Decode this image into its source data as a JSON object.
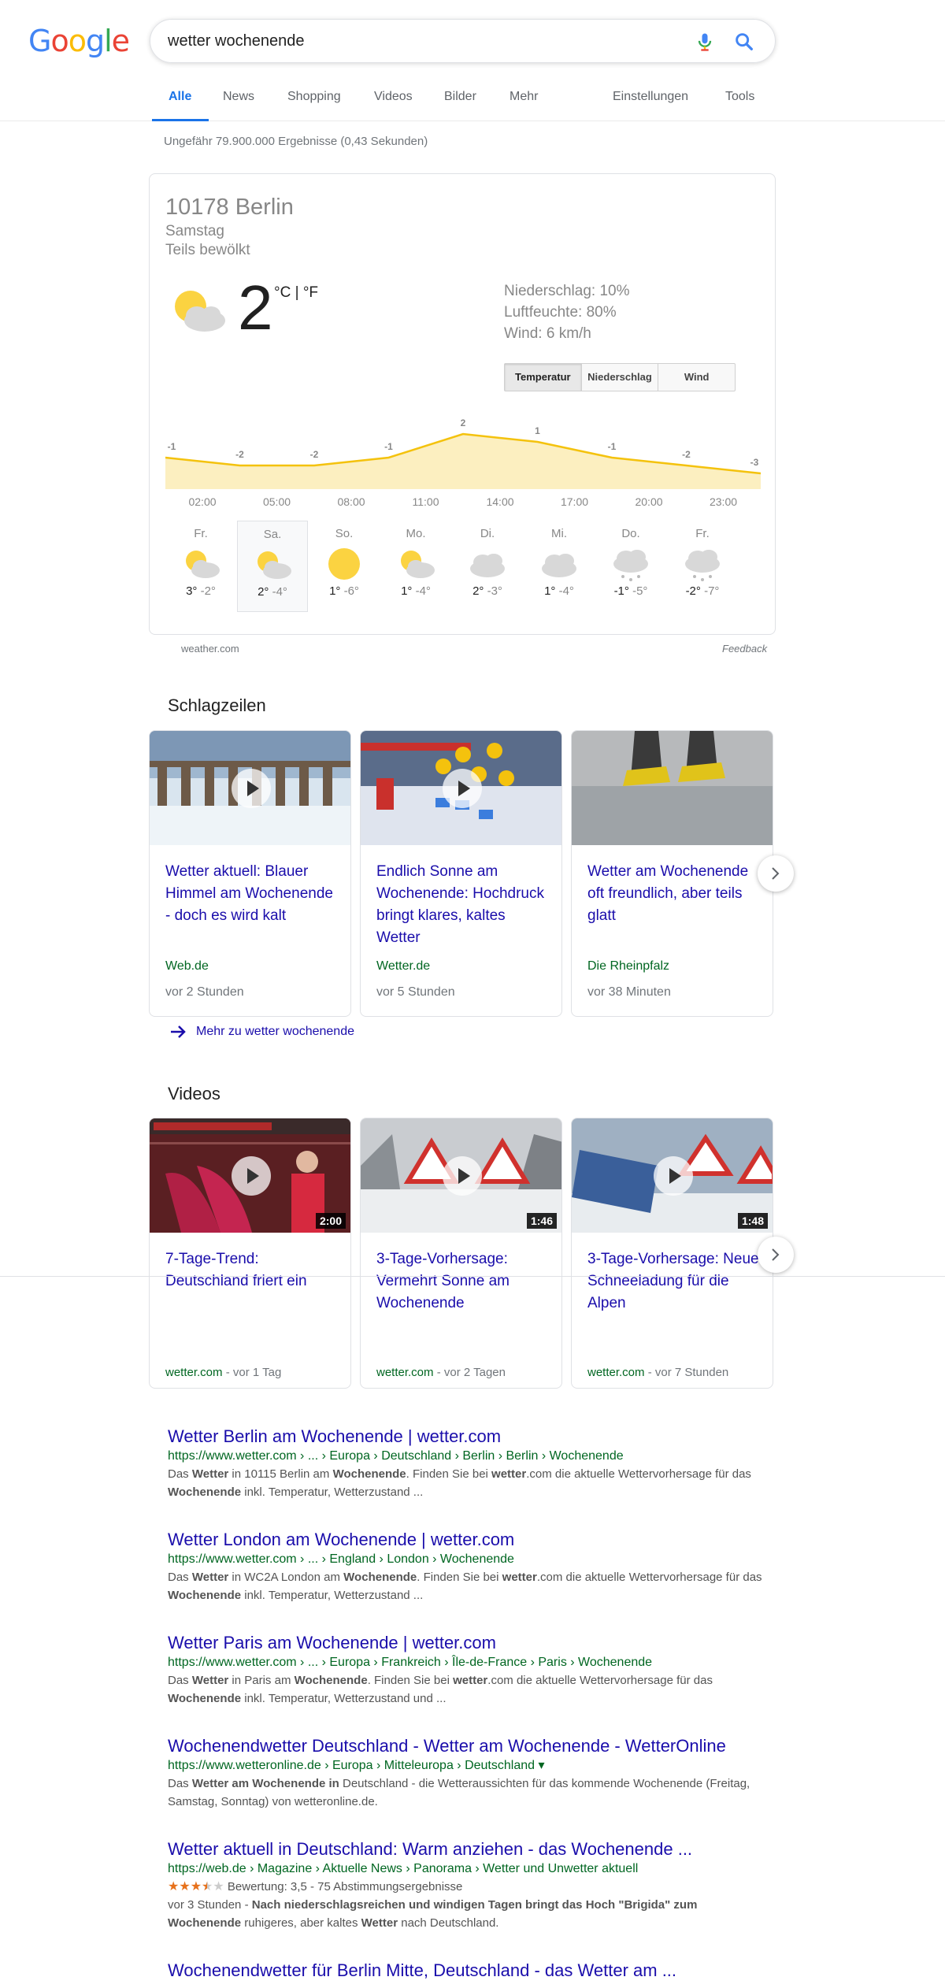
{
  "header": {
    "logo": [
      "G",
      "o",
      "o",
      "g",
      "l",
      "e"
    ],
    "logo_colors": [
      "#4285f4",
      "#ea4335",
      "#fbbc05",
      "#4285f4",
      "#34a853",
      "#ea4335"
    ],
    "query": "wetter wochenende"
  },
  "tabs": {
    "all": "Alle",
    "news": "News",
    "shopping": "Shopping",
    "videos": "Videos",
    "images": "Bilder",
    "more": "Mehr",
    "settings": "Einstellungen",
    "tools": "Tools"
  },
  "stats": "Ungefähr 79.900.000 Ergebnisse (0,43 Sekunden)",
  "weather": {
    "location": "10178 Berlin",
    "day": "Samstag",
    "condition": "Teils bewölkt",
    "temp": "2",
    "units": "°C | °F",
    "precipitation": "Niederschlag: 10%",
    "humidity": "Luftfeuchte: 80%",
    "wind": "Wind: 6 km/h",
    "buttons": [
      "Temperatur",
      "Niederschlag",
      "Wind"
    ],
    "chart_data": {
      "type": "area",
      "x": [
        "02:00",
        "05:00",
        "08:00",
        "11:00",
        "14:00",
        "17:00",
        "20:00",
        "23:00"
      ],
      "values": [
        -1,
        -2,
        -2,
        -1,
        2,
        1,
        -1,
        -2,
        -3
      ],
      "labels": [
        "-1",
        "-2",
        "-2",
        "-1",
        "2",
        "1",
        "-1",
        "-2",
        "-3"
      ],
      "color": "#f4c20d"
    },
    "forecast": [
      {
        "day": "Fr.",
        "hi": "3°",
        "lo": "-2°",
        "icon": "partly-cloudy-icon"
      },
      {
        "day": "Sa.",
        "hi": "2°",
        "lo": "-4°",
        "icon": "partly-cloudy-icon"
      },
      {
        "day": "So.",
        "hi": "1°",
        "lo": "-6°",
        "icon": "sunny-icon"
      },
      {
        "day": "Mo.",
        "hi": "1°",
        "lo": "-4°",
        "icon": "partly-cloudy-icon"
      },
      {
        "day": "Di.",
        "hi": "2°",
        "lo": "-3°",
        "icon": "cloudy-icon"
      },
      {
        "day": "Mi.",
        "hi": "1°",
        "lo": "-4°",
        "icon": "cloudy-icon"
      },
      {
        "day": "Do.",
        "hi": "-1°",
        "lo": "-5°",
        "icon": "snow-icon"
      },
      {
        "day": "Fr.",
        "hi": "-2°",
        "lo": "-7°",
        "icon": "snow-icon"
      }
    ],
    "source": "weather.com",
    "feedback": "Feedback"
  },
  "headlines": {
    "heading": "Schlagzeilen",
    "items": [
      {
        "title": "Wetter aktuell: Blauer Himmel am Wochenende - doch es wird kalt",
        "source": "Web.de",
        "age": "vor 2 Stunden"
      },
      {
        "title": "Endlich Sonne am Wochenende: Hochdruck bringt klares, kaltes Wetter",
        "source": "Wetter.de",
        "age": "vor 5 Stunden"
      },
      {
        "title": "Wetter am Wochenende oft freundlich, aber teils glatt",
        "source": "Die Rheinpfalz",
        "age": "vor 38 Minuten"
      }
    ],
    "more": "Mehr zu wetter wochenende"
  },
  "videos": {
    "heading": "Videos",
    "items": [
      {
        "title": "7-Tage-Trend: Deutschland friert ein",
        "duration": "2:00",
        "source": "wetter.com",
        "age": " - vor 1 Tag"
      },
      {
        "title": "3-Tage-Vorhersage: Vermehrt Sonne am Wochenende",
        "duration": "1:46",
        "source": "wetter.com",
        "age": " - vor 2 Tagen"
      },
      {
        "title": "3-Tage-Vorhersage: Neue Schneeladung für die Alpen",
        "duration": "1:48",
        "source": "wetter.com",
        "age": " - vor 7 Stunden"
      }
    ]
  },
  "results": [
    {
      "title": "Wetter Berlin am Wochenende | wetter.com",
      "url": "https://www.wetter.com › ... › Europa › Deutschland › Berlin › Berlin › Wochenende",
      "snippet": "Das <b>Wetter</b> in 10115 Berlin am <b>Wochenende</b>. Finden Sie bei <b>wetter</b>.com die aktuelle Wettervorhersage für das <b>Wochenende</b> inkl. Temperatur, Wetterzustand ..."
    },
    {
      "title": "Wetter London am Wochenende | wetter.com",
      "url": "https://www.wetter.com › ... › England › London › Wochenende",
      "snippet": "Das <b>Wetter</b> in WC2A London am <b>Wochenende</b>. Finden Sie bei <b>wetter</b>.com die aktuelle Wettervorhersage für das <b>Wochenende</b> inkl. Temperatur, Wetterzustand ..."
    },
    {
      "title": "Wetter Paris am Wochenende | wetter.com",
      "url": "https://www.wetter.com › ... › Europa › Frankreich › Île-de-France › Paris › Wochenende",
      "snippet": "Das <b>Wetter</b> in Paris am <b>Wochenende</b>. Finden Sie bei <b>wetter</b>.com die aktuelle Wettervorhersage für das <b>Wochenende</b> inkl. Temperatur, Wetterzustand und ..."
    },
    {
      "title": "Wochenendwetter Deutschland - Wetter am Wochenende - WetterOnline",
      "url": "https://www.wetteronline.de › Europa › Mitteleuropa › Deutschland ▾",
      "snippet": "Das <b>Wetter am Wochenende in</b> Deutschland - die Wetteraussichten für das kommende Wochenende (Freitag, Samstag, Sonntag) von wetteronline.de."
    },
    {
      "title": "Wetter aktuell in Deutschland: Warm anziehen - das Wochenende ...",
      "url": "https://web.de › Magazine › Aktuelle News › Panorama › Wetter und Unwetter aktuell",
      "rating": "Bewertung: 3,5 - 75 Abstimmungsergebnisse",
      "rating_value": 3.5,
      "snippet": "vor 3 Stunden - <b>Nach niederschlagsreichen und windigen Tagen bringt das Hoch \"Brigida\" zum</b> <b>Wochenende</b> ruhigeres, aber kaltes <b>Wetter</b> nach Deutschland."
    },
    {
      "title": "Wochenendwetter für Berlin Mitte, Deutschland - das Wetter am ...",
      "url": "",
      "snippet": ""
    }
  ]
}
